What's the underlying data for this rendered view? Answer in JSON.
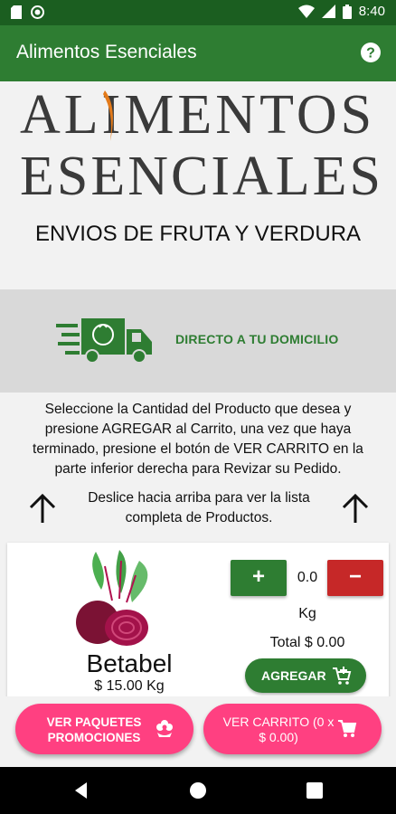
{
  "status_bar": {
    "time": "8:40"
  },
  "app_bar": {
    "title": "Alimentos Esenciales",
    "help_icon": "help-circle-icon"
  },
  "logo": {
    "line1": "ALIMENTOS",
    "line2": "ESENCIALES",
    "accent": "#e37a1a"
  },
  "tagline": "ENVIOS DE FRUTA Y VERDURA",
  "banner": {
    "text": "DIRECTO A TU DOMICILIO"
  },
  "instructions": "Seleccione la Cantidad del Producto que desea y presione AGREGAR al Carrito, una vez que haya terminado, presione el botón de VER CARRITO en la parte inferior derecha para Revizar su Pedido.",
  "scroll_hint": "Deslice hacia arriba para ver la lista completa de Productos.",
  "product": {
    "name": "Betabel",
    "price": "$ 15.00 Kg",
    "quantity": "0.0",
    "unit": "Kg",
    "total": "Total $ 0.00",
    "plus_label": "+",
    "minus_label": "−",
    "add_label": "AGREGAR"
  },
  "bottom_buttons": {
    "promos_label": "VER PAQUETES PROMOCIONES",
    "cart_label": "VER CARRITO (0 x $ 0.00)"
  },
  "colors": {
    "primary_dark": "#1b5e20",
    "primary": "#2e7d32",
    "accent_pink": "#ff4081",
    "danger": "#c62828"
  }
}
